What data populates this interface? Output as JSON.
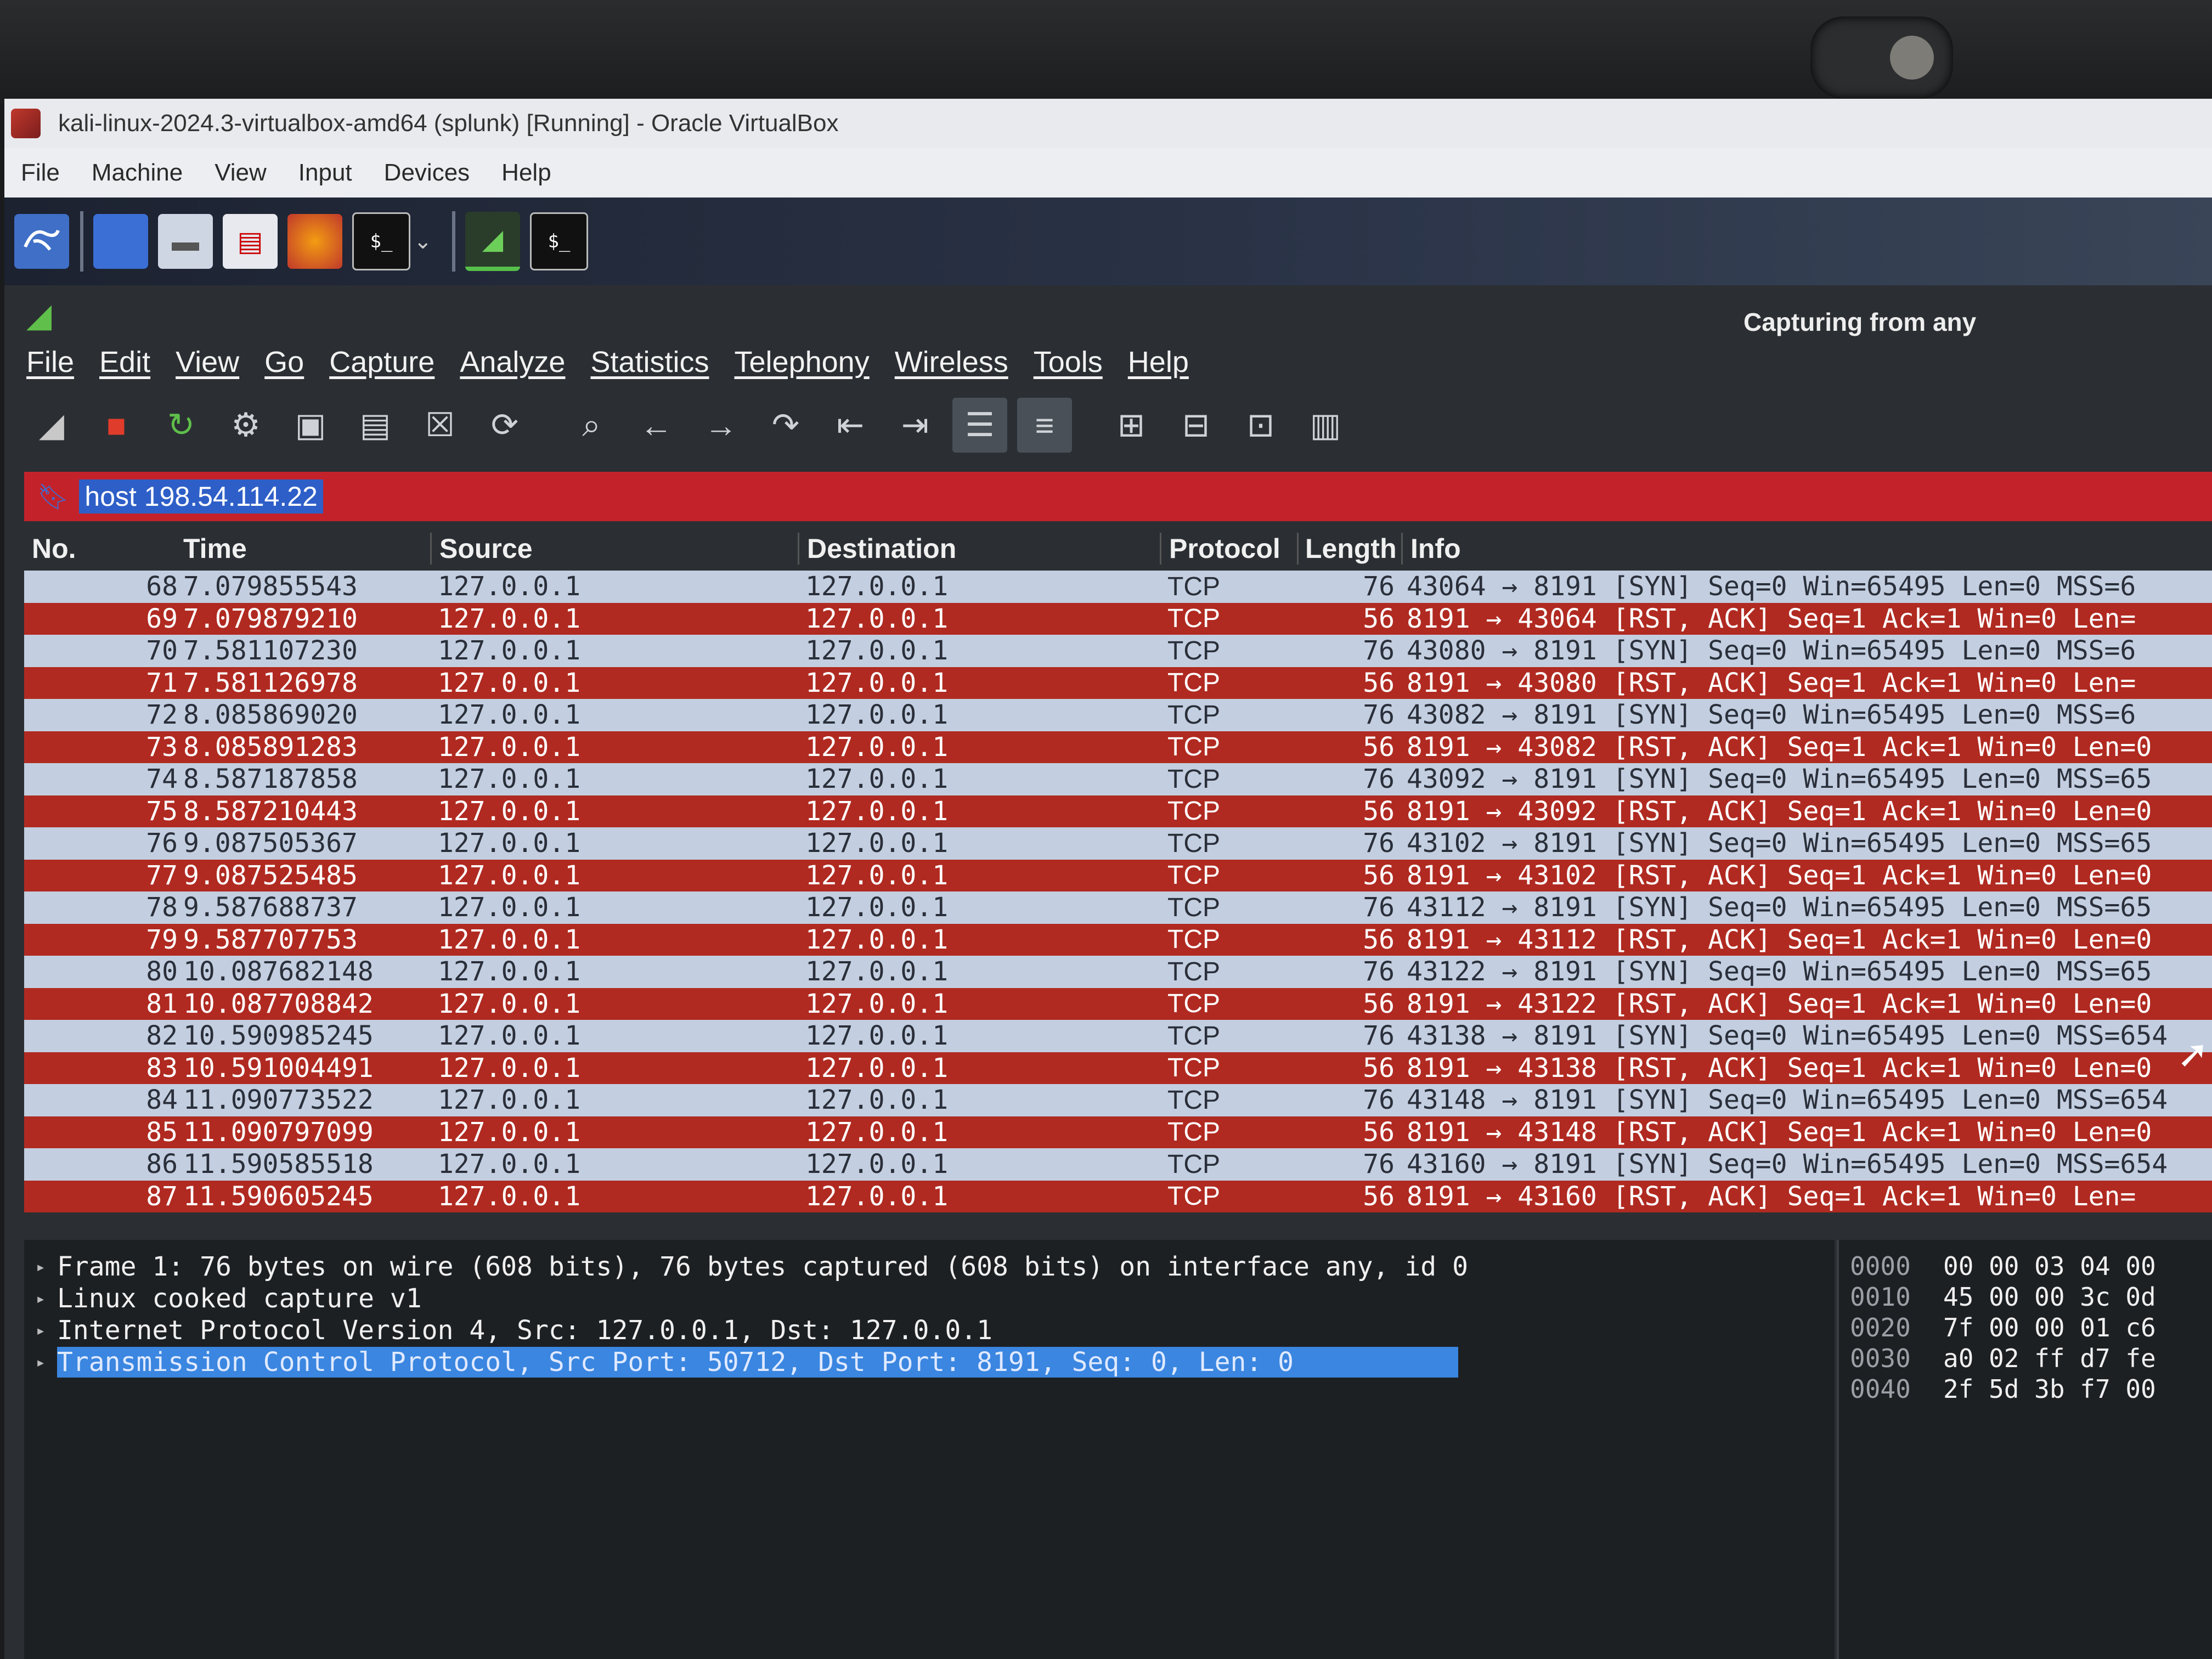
{
  "virtualbox": {
    "title": "kali-linux-2024.3-virtualbox-amd64 (splunk) [Running] - Oracle VirtualBox",
    "menu": [
      "File",
      "Machine",
      "View",
      "Input",
      "Devices",
      "Help"
    ]
  },
  "kali_panel": {
    "icons": [
      "kali-menu-icon",
      "workspace-icon",
      "file-manager-icon",
      "text-editor-icon",
      "firefox-icon",
      "terminal-icon",
      "chevron-down-icon",
      "wireshark-icon",
      "terminal-icon"
    ],
    "terminal_glyph": "$_"
  },
  "wireshark": {
    "status": "Capturing from any",
    "menu": [
      "File",
      "Edit",
      "View",
      "Go",
      "Capture",
      "Analyze",
      "Statistics",
      "Telephony",
      "Wireless",
      "Tools",
      "Help"
    ],
    "filter": "host 198.54.114.22",
    "columns": [
      "No.",
      "Time",
      "Source",
      "Destination",
      "Protocol",
      "Length",
      "Info"
    ],
    "packets": [
      {
        "no": "68",
        "time": "7.079855543",
        "src": "127.0.0.1",
        "dst": "127.0.0.1",
        "proto": "TCP",
        "len": "76",
        "info": "43064 → 8191 [SYN] Seq=0 Win=65495 Len=0 MSS=6",
        "type": "syn"
      },
      {
        "no": "69",
        "time": "7.079879210",
        "src": "127.0.0.1",
        "dst": "127.0.0.1",
        "proto": "TCP",
        "len": "56",
        "info": "8191 → 43064 [RST, ACK] Seq=1 Ack=1 Win=0 Len=",
        "type": "rst"
      },
      {
        "no": "70",
        "time": "7.581107230",
        "src": "127.0.0.1",
        "dst": "127.0.0.1",
        "proto": "TCP",
        "len": "76",
        "info": "43080 → 8191 [SYN] Seq=0 Win=65495 Len=0 MSS=6",
        "type": "syn"
      },
      {
        "no": "71",
        "time": "7.581126978",
        "src": "127.0.0.1",
        "dst": "127.0.0.1",
        "proto": "TCP",
        "len": "56",
        "info": "8191 → 43080 [RST, ACK] Seq=1 Ack=1 Win=0 Len=",
        "type": "rst"
      },
      {
        "no": "72",
        "time": "8.085869020",
        "src": "127.0.0.1",
        "dst": "127.0.0.1",
        "proto": "TCP",
        "len": "76",
        "info": "43082 → 8191 [SYN] Seq=0 Win=65495 Len=0 MSS=6",
        "type": "syn"
      },
      {
        "no": "73",
        "time": "8.085891283",
        "src": "127.0.0.1",
        "dst": "127.0.0.1",
        "proto": "TCP",
        "len": "56",
        "info": "8191 → 43082 [RST, ACK] Seq=1 Ack=1 Win=0 Len=0",
        "type": "rst"
      },
      {
        "no": "74",
        "time": "8.587187858",
        "src": "127.0.0.1",
        "dst": "127.0.0.1",
        "proto": "TCP",
        "len": "76",
        "info": "43092 → 8191 [SYN] Seq=0 Win=65495 Len=0 MSS=65",
        "type": "syn"
      },
      {
        "no": "75",
        "time": "8.587210443",
        "src": "127.0.0.1",
        "dst": "127.0.0.1",
        "proto": "TCP",
        "len": "56",
        "info": "8191 → 43092 [RST, ACK] Seq=1 Ack=1 Win=0 Len=0",
        "type": "rst"
      },
      {
        "no": "76",
        "time": "9.087505367",
        "src": "127.0.0.1",
        "dst": "127.0.0.1",
        "proto": "TCP",
        "len": "76",
        "info": "43102 → 8191 [SYN] Seq=0 Win=65495 Len=0 MSS=65",
        "type": "syn"
      },
      {
        "no": "77",
        "time": "9.087525485",
        "src": "127.0.0.1",
        "dst": "127.0.0.1",
        "proto": "TCP",
        "len": "56",
        "info": "8191 → 43102 [RST, ACK] Seq=1 Ack=1 Win=0 Len=0",
        "type": "rst"
      },
      {
        "no": "78",
        "time": "9.587688737",
        "src": "127.0.0.1",
        "dst": "127.0.0.1",
        "proto": "TCP",
        "len": "76",
        "info": "43112 → 8191 [SYN] Seq=0 Win=65495 Len=0 MSS=65",
        "type": "syn"
      },
      {
        "no": "79",
        "time": "9.587707753",
        "src": "127.0.0.1",
        "dst": "127.0.0.1",
        "proto": "TCP",
        "len": "56",
        "info": "8191 → 43112 [RST, ACK] Seq=1 Ack=1 Win=0 Len=0",
        "type": "rst"
      },
      {
        "no": "80",
        "time": "10.087682148",
        "src": "127.0.0.1",
        "dst": "127.0.0.1",
        "proto": "TCP",
        "len": "76",
        "info": "43122 → 8191 [SYN] Seq=0 Win=65495 Len=0 MSS=65",
        "type": "syn"
      },
      {
        "no": "81",
        "time": "10.087708842",
        "src": "127.0.0.1",
        "dst": "127.0.0.1",
        "proto": "TCP",
        "len": "56",
        "info": "8191 → 43122 [RST, ACK] Seq=1 Ack=1 Win=0 Len=0",
        "type": "rst"
      },
      {
        "no": "82",
        "time": "10.590985245",
        "src": "127.0.0.1",
        "dst": "127.0.0.1",
        "proto": "TCP",
        "len": "76",
        "info": "43138 → 8191 [SYN] Seq=0 Win=65495 Len=0 MSS=654",
        "type": "syn"
      },
      {
        "no": "83",
        "time": "10.591004491",
        "src": "127.0.0.1",
        "dst": "127.0.0.1",
        "proto": "TCP",
        "len": "56",
        "info": "8191 → 43138 [RST, ACK] Seq=1 Ack=1 Win=0 Len=0",
        "type": "rst"
      },
      {
        "no": "84",
        "time": "11.090773522",
        "src": "127.0.0.1",
        "dst": "127.0.0.1",
        "proto": "TCP",
        "len": "76",
        "info": "43148 → 8191 [SYN] Seq=0 Win=65495 Len=0 MSS=654",
        "type": "syn"
      },
      {
        "no": "85",
        "time": "11.090797099",
        "src": "127.0.0.1",
        "dst": "127.0.0.1",
        "proto": "TCP",
        "len": "56",
        "info": "8191 → 43148 [RST, ACK] Seq=1 Ack=1 Win=0 Len=0",
        "type": "rst"
      },
      {
        "no": "86",
        "time": "11.590585518",
        "src": "127.0.0.1",
        "dst": "127.0.0.1",
        "proto": "TCP",
        "len": "76",
        "info": "43160 → 8191 [SYN] Seq=0 Win=65495 Len=0 MSS=654",
        "type": "syn"
      },
      {
        "no": "87",
        "time": "11.590605245",
        "src": "127.0.0.1",
        "dst": "127.0.0.1",
        "proto": "TCP",
        "len": "56",
        "info": "8191 → 43160 [RST, ACK] Seq=1 Ack=1 Win=0 Len=",
        "type": "rst"
      }
    ],
    "details": [
      "Frame 1: 76 bytes on wire (608 bits), 76 bytes captured (608 bits) on interface any, id 0",
      "Linux cooked capture v1",
      "Internet Protocol Version 4, Src: 127.0.0.1, Dst: 127.0.0.1",
      "Transmission Control Protocol, Src Port: 50712, Dst Port: 8191, Seq: 0, Len: 0"
    ],
    "bytes": [
      {
        "offset": "0000",
        "hex": "00 00 03 04 00"
      },
      {
        "offset": "0010",
        "hex": "45 00 00 3c 0d"
      },
      {
        "offset": "0020",
        "hex": "7f 00 00 01 c6"
      },
      {
        "offset": "0030",
        "hex": "a0 02 ff d7 fe"
      },
      {
        "offset": "0040",
        "hex": "2f 5d 3b f7 00"
      }
    ],
    "colors": {
      "syn_row": "#c3cfe0",
      "rst_row": "#b02a21",
      "filter_bar": "#c4222a",
      "selection": "#3a86e0"
    }
  }
}
